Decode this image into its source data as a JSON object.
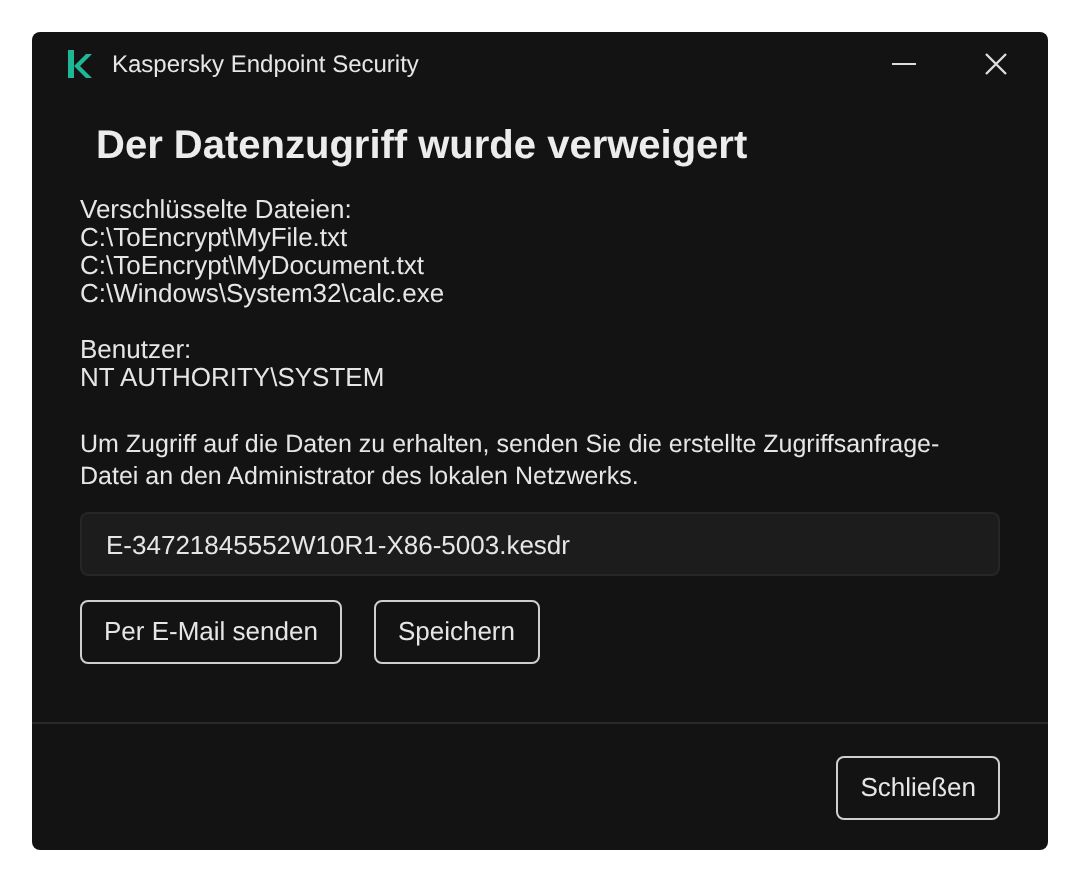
{
  "window": {
    "title": "Kaspersky Endpoint Security"
  },
  "heading": "Der Datenzugriff wurde verweigert",
  "sections": [
    {
      "label": "Verschlüsselte Dateien:",
      "lines": [
        "C:\\ToEncrypt\\MyFile.txt",
        "C:\\ToEncrypt\\MyDocument.txt",
        "C:\\Windows\\System32\\calc.exe"
      ]
    },
    {
      "label": "Benutzer:",
      "lines": [
        "NT AUTHORITY\\SYSTEM"
      ]
    }
  ],
  "instruction": "Um Zugriff auf die Daten zu erhalten, senden Sie die erstellte Zugriffsanfrage-Datei an den Administrator des lokalen Netzwerks.",
  "file_field": {
    "value": "E-34721845552W10R1-X86-5003.kesdr"
  },
  "buttons": [
    "Per E-Mail senden",
    "Speichern"
  ],
  "close_button": "Schließen"
}
